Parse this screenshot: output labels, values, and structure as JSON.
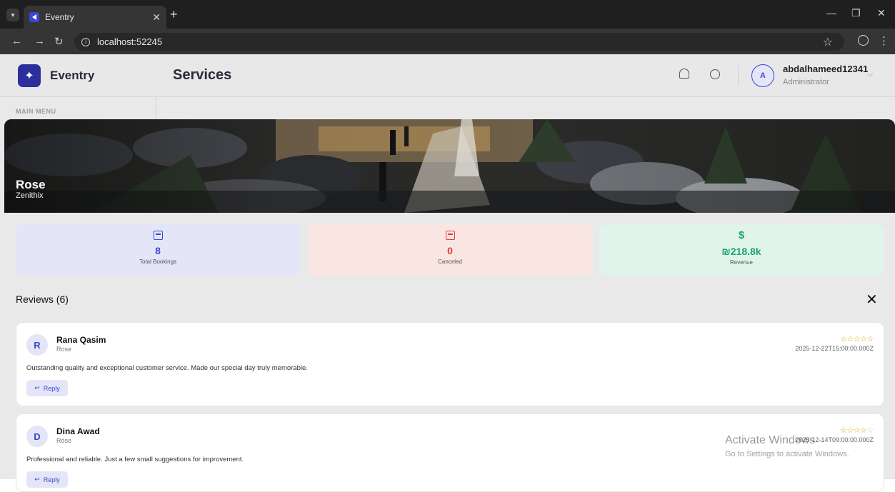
{
  "browser": {
    "tab_title": "Eventry",
    "url": "localhost:52245"
  },
  "app": {
    "logo_text": "Eventry",
    "page_title": "Services",
    "menu_label": "MAIN MENU",
    "user": {
      "avatar_letter": "A",
      "name": "abdalhameed12341",
      "role": "Administrator"
    }
  },
  "hero": {
    "title": "Rose",
    "subtitle": "Zenithix"
  },
  "stats": {
    "total_bookings": {
      "value": "8",
      "label": "Total Bookings",
      "icon": "calendar-check-icon",
      "color": "#3b46d6"
    },
    "canceled": {
      "value": "0",
      "label": "Canceled",
      "icon": "calendar-x-icon",
      "color": "#e33b3b"
    },
    "revenue": {
      "value": "₪218.8k",
      "label": "Revenue",
      "icon": "dollar-icon",
      "symbol": "$",
      "color": "#1aa56d"
    }
  },
  "reviews": {
    "title": "Reviews (6)",
    "reply_label": "Reply",
    "items": [
      {
        "initial": "R",
        "name": "Rana Qasim",
        "service": "Rose",
        "stars_filled": "☆☆☆☆☆",
        "stars_empty": "",
        "date": "2025-12-22T15:00:00.000Z",
        "text": "Outstanding quality and exceptional customer service. Made our special day truly memorable.",
        "rating": 5
      },
      {
        "initial": "D",
        "name": "Dina Awad",
        "service": "Rose",
        "stars_filled": "☆☆☆☆",
        "stars_empty": "☆",
        "date": "2025-12-14T09:00:00.000Z",
        "text": "Professional and reliable. Just a few small suggestions for improvement.",
        "rating": 4
      }
    ]
  },
  "watermark": {
    "title": "Activate Windows",
    "subtitle": "Go to Settings to activate Windows."
  }
}
